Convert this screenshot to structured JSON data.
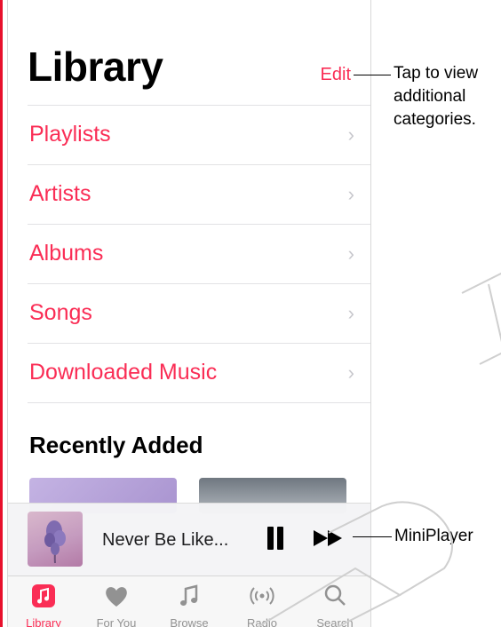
{
  "header": {
    "title": "Library",
    "edit_label": "Edit"
  },
  "menu": {
    "items": [
      {
        "label": "Playlists"
      },
      {
        "label": "Artists"
      },
      {
        "label": "Albums"
      },
      {
        "label": "Songs"
      },
      {
        "label": "Downloaded Music"
      }
    ]
  },
  "recently_added": {
    "title": "Recently Added"
  },
  "mini_player": {
    "song_title": "Never Be Like..."
  },
  "tabs": [
    {
      "label": "Library",
      "icon": "music-note-square-icon",
      "active": true
    },
    {
      "label": "For You",
      "icon": "heart-icon"
    },
    {
      "label": "Browse",
      "icon": "music-note-icon"
    },
    {
      "label": "Radio",
      "icon": "radio-waves-icon"
    },
    {
      "label": "Search",
      "icon": "search-icon"
    }
  ],
  "callouts": {
    "edit_callout": "Tap to view additional categories.",
    "miniplayer_callout": "MiniPlayer"
  },
  "colors": {
    "accent": "#fa2d55",
    "inactive_tab": "#929292"
  }
}
